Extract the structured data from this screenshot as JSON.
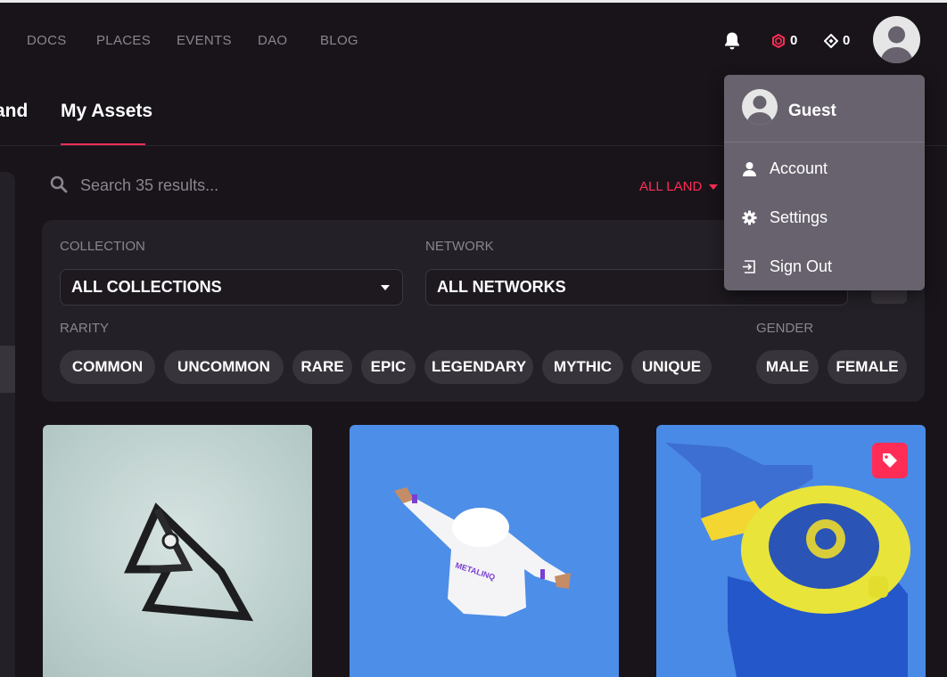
{
  "nav": {
    "links": [
      "DOCS",
      "PLACES",
      "EVENTS",
      "DAO",
      "BLOG"
    ],
    "mana_red": "0",
    "mana_grey": "0"
  },
  "tabs": {
    "land_partial": "and",
    "my_assets": "My Assets"
  },
  "search": {
    "placeholder": "Search 35 results..."
  },
  "land_filter": {
    "label": "ALL LAND"
  },
  "filters": {
    "collection_label": "COLLECTION",
    "collection_value": "ALL COLLECTIONS",
    "network_label": "NETWORK",
    "network_value": "ALL NETWORKS",
    "rarity_label": "RARITY",
    "rarities": [
      "COMMON",
      "UNCOMMON",
      "RARE",
      "EPIC",
      "LEGENDARY",
      "MYTHIC",
      "UNIQUE"
    ],
    "gender_label": "GENDER",
    "genders": [
      "MALE",
      "FEMALE"
    ]
  },
  "cards": [
    {
      "name": "triangle-logo-asset"
    },
    {
      "name": "hoodie-asset",
      "print": "METALINQ"
    },
    {
      "name": "watch-asset"
    }
  ],
  "profile_menu": {
    "name": "Guest",
    "items": [
      "Account",
      "Settings",
      "Sign Out"
    ]
  },
  "colors": {
    "accent": "#ff2d55",
    "bg": "#18141a",
    "panel": "#242027",
    "menu": "#68626e"
  }
}
